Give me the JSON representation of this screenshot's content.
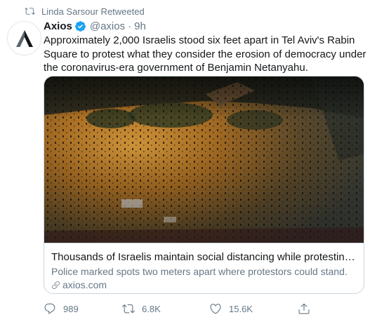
{
  "retweet_context": {
    "text": "Linda Sarsour Retweeted",
    "icon": "retweet-icon"
  },
  "tweet": {
    "author_name": "Axios",
    "handle": "@axios",
    "separator": "·",
    "time": "9h",
    "verified_icon": "verified-badge-icon",
    "avatar_icon": "axios-logo",
    "text": "Approximately 2,000 Israelis stood six feet apart in Tel Aviv's Rabin Square to protest what they consider the erosion of democracy under the coronavirus-era government of Benjamin Netanyahu."
  },
  "card": {
    "title": "Thousands of Israelis maintain social distancing while protesting Netany…",
    "description": "Police marked spots two meters apart where protestors could stand.",
    "domain": "axios.com",
    "domain_icon": "link-icon"
  },
  "actions": {
    "replies": "989",
    "retweets": "6.8K",
    "likes": "15.6K",
    "reply_icon": "reply-icon",
    "retweet_icon": "retweet-icon",
    "like_icon": "heart-icon",
    "share_icon": "share-icon"
  },
  "colors": {
    "text_primary": "#14171a",
    "text_secondary": "#657786",
    "border": "#ccd6dd",
    "verified_blue": "#1da1f2"
  }
}
